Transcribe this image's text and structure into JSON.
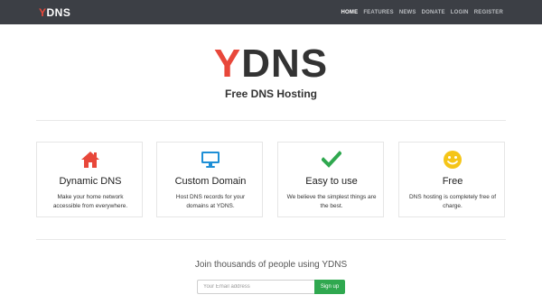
{
  "navbar": {
    "brand_y": "Y",
    "brand_rest": "DNS",
    "items": [
      {
        "label": "HOME",
        "active": true
      },
      {
        "label": "FEATURES"
      },
      {
        "label": "NEWS"
      },
      {
        "label": "DONATE"
      },
      {
        "label": "LOGIN"
      },
      {
        "label": "REGISTER"
      }
    ]
  },
  "hero": {
    "logo_y": "Y",
    "logo_rest": "DNS",
    "tagline": "Free DNS Hosting"
  },
  "features": [
    {
      "icon": "home-icon",
      "title": "Dynamic DNS",
      "desc": "Make your home network accessible from everywhere."
    },
    {
      "icon": "monitor-icon",
      "title": "Custom Domain",
      "desc": "Host DNS records for your domains at YDNS."
    },
    {
      "icon": "checkmark-icon",
      "title": "Easy to use",
      "desc": "We believe the simplest things are the best."
    },
    {
      "icon": "smiley-icon",
      "title": "Free",
      "desc": "DNS hosting is completely free of charge."
    }
  ],
  "signup": {
    "heading": "Join thousands of people using YDNS",
    "email_placeholder": "Your Email address",
    "button_label": "Sign up"
  },
  "colors": {
    "navbar_bg": "#3c3f45",
    "brand_accent": "#e8473a",
    "home_icon": "#e8473a",
    "monitor_icon": "#1e8fd6",
    "check_icon": "#2fa84f",
    "smiley_icon": "#f5c518",
    "signup_button": "#2fa84f"
  }
}
